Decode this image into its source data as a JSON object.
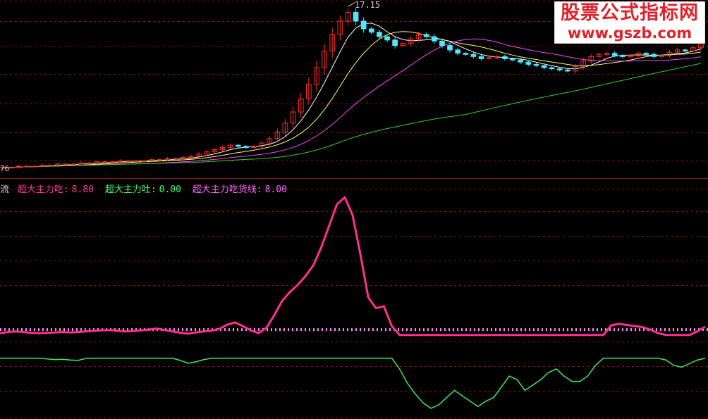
{
  "watermark": {
    "title": "股票公式指标网",
    "url": "www.gszb.com"
  },
  "price_panel": {
    "peak_label": "17.15",
    "low_label": "76"
  },
  "indicator_panel": {
    "legend": [
      {
        "label": "流",
        "value": "",
        "color": "#cfcfcf"
      },
      {
        "label": "超大主力吃:",
        "value": "8.80",
        "color": "#ff3c9a"
      },
      {
        "label": "超大主力吐:",
        "value": "0.00",
        "color": "#3cff6a"
      },
      {
        "label": "超大主力吃货线:",
        "value": "8.00",
        "color": "#ff66ff"
      }
    ]
  },
  "colors": {
    "background": "#000000",
    "grid": "#8a1414",
    "candle_up": "#ff2d2d",
    "candle_down": "#4fe6ff",
    "ma5": "#ffffff",
    "ma10": "#ffff66",
    "ma20": "#ff44ff",
    "ma60": "#33cc33",
    "eat_line": "#ff2f8f",
    "spit_line": "#3cdc5c",
    "threshold": "#ff88ff",
    "watermark_text": "#e2202a"
  },
  "chart_data": [
    {
      "type": "candlestick",
      "title": "",
      "description_series": [
        {
          "name": "",
          "values": [
            3.0,
            3.0,
            3.1,
            3.1,
            3.1,
            3.2,
            3.2,
            3.3,
            3.3,
            3.3,
            3.4,
            3.4,
            3.5,
            3.5,
            3.5,
            3.6,
            3.6,
            3.6,
            3.6,
            3.7,
            3.7,
            3.8,
            3.8,
            3.9,
            4.0,
            4.2,
            4.4,
            4.6,
            4.8,
            5.0,
            4.9,
            4.8,
            4.9,
            5.2,
            5.6,
            6.2,
            7.0,
            8.0,
            9.2,
            10.5,
            12.0,
            13.5,
            15.0,
            16.2,
            17.0,
            16.2,
            15.5,
            15.2,
            14.8,
            14.5,
            14.0,
            14.2,
            14.6,
            15.0,
            14.8,
            14.4,
            14.0,
            13.6,
            13.3,
            13.2,
            13.0,
            12.8,
            12.9,
            13.0,
            12.8,
            12.7,
            12.5,
            12.3,
            12.2,
            12.0,
            11.9,
            11.8,
            11.7,
            12.1,
            12.6,
            13.0,
            13.2,
            13.3,
            13.1,
            13.0,
            13.1,
            13.3,
            13.2,
            13.0,
            13.1,
            13.4,
            13.6,
            13.5,
            13.8,
            14.2
          ]
        }
      ]
    },
    {
      "type": "line",
      "title": "",
      "series": [
        {
          "name": "超大主力吃",
          "values": [
            7.0,
            7.3,
            7.5,
            7.3,
            7.1,
            7.0,
            7.1,
            7.2,
            7.3,
            7.2,
            7.3,
            7.5,
            7.7,
            7.8,
            7.9,
            7.7,
            7.5,
            7.6,
            7.8,
            8.0,
            8.3,
            7.9,
            7.5,
            7.1,
            6.9,
            7.2,
            7.5,
            7.7,
            8.2,
            9.4,
            10.0,
            9.0,
            7.8,
            7.0,
            8.5,
            12.0,
            16.0,
            18.5,
            20.5,
            23.0,
            26.0,
            31.0,
            37.0,
            43.0,
            45.0,
            40.0,
            29.0,
            17.0,
            14.0,
            14.5,
            9.0,
            6.5,
            6.5,
            6.5,
            6.5,
            6.5,
            6.5,
            6.5,
            6.5,
            6.5,
            6.5,
            6.5,
            6.5,
            6.5,
            6.5,
            6.5,
            6.5,
            6.5,
            6.5,
            6.5,
            6.5,
            6.5,
            6.5,
            6.5,
            6.5,
            6.5,
            6.5,
            6.5,
            9.2,
            9.6,
            9.3,
            9.0,
            8.7,
            8.0,
            7.0,
            6.5,
            6.5,
            6.5,
            6.5,
            7.5,
            8.8
          ]
        },
        {
          "name": "超大主力吐",
          "values": [
            0,
            0,
            0,
            0,
            0,
            0,
            -0.2,
            -0.4,
            -0.3,
            -0.5,
            -0.6,
            0,
            0,
            0,
            0,
            0,
            0,
            0,
            0,
            0,
            0,
            0,
            0,
            -0.6,
            -1.4,
            -1.0,
            -0.4,
            0,
            0,
            0,
            0,
            0,
            0,
            0,
            0,
            0,
            0,
            0,
            0,
            0,
            0,
            0,
            0,
            0,
            0,
            0,
            0,
            0,
            0,
            0,
            0,
            -3.0,
            -7.0,
            -10.0,
            -12.5,
            -14.0,
            -13.0,
            -11.0,
            -9.0,
            -10.5,
            -12.0,
            -13.5,
            -12.0,
            -11.0,
            -8.0,
            -5.0,
            -6.0,
            -9.0,
            -7.5,
            -6.0,
            -4.0,
            -3.0,
            -5.0,
            -6.5,
            -6.5,
            -5.0,
            -2.0,
            0,
            0,
            0,
            0,
            0,
            0,
            0,
            0,
            -0.5,
            -2.0,
            -2.5,
            -1.5,
            -0.5,
            0
          ]
        },
        {
          "name": "超大主力吃货线",
          "values": [
            8.0
          ]
        }
      ]
    }
  ]
}
